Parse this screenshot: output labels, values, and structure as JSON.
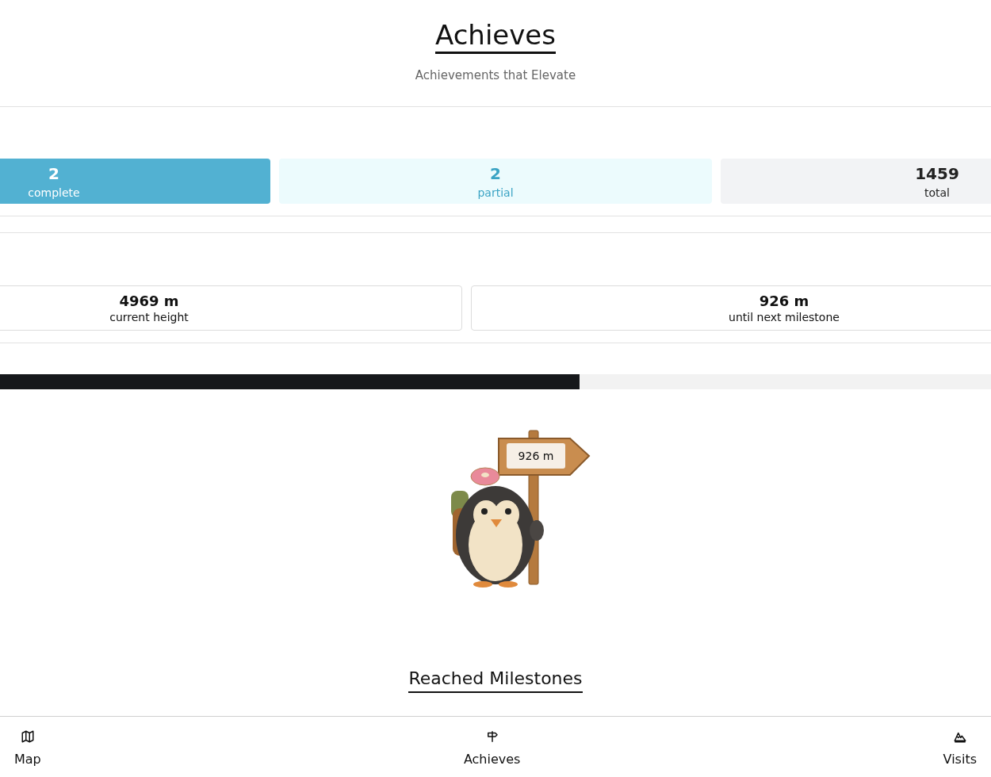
{
  "header": {
    "title": "Achieves",
    "subtitle": "Achievements that Elevate"
  },
  "stats": [
    {
      "kind": "complete",
      "value": "2",
      "label": "complete"
    },
    {
      "kind": "partial",
      "value": "2",
      "label": "partial"
    },
    {
      "kind": "total",
      "value": "1459",
      "label": "total"
    }
  ],
  "heights": [
    {
      "value": "4969 m",
      "label": "current height"
    },
    {
      "value": "926 m",
      "label": "until next milestone"
    }
  ],
  "progress": {
    "level": 0.585
  },
  "illustration": {
    "sign": "926 m"
  },
  "milestones": {
    "title": "Reached Milestones"
  },
  "nav": [
    {
      "kind": "map",
      "label": "Map"
    },
    {
      "kind": "signpost",
      "label": "Achieves"
    },
    {
      "kind": "mountain",
      "label": "Visits"
    }
  ]
}
